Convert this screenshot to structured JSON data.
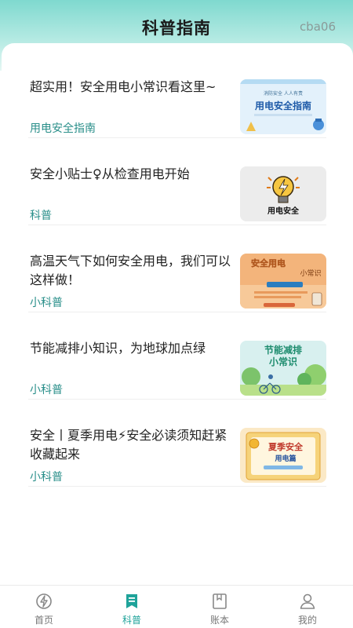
{
  "header": {
    "title": "科普指南",
    "tag": "cba06"
  },
  "articles": [
    {
      "title": "超实用！安全用电小常识看这里~",
      "source": "用电安全指南",
      "thumb": {
        "line1": "消防安全 人人有责",
        "line2": "用电安全指南"
      }
    },
    {
      "title": "安全小贴士♀从检查用电开始",
      "source": "科普",
      "thumb": {
        "line1": "用电安全"
      }
    },
    {
      "title": "高温天气下如何安全用电，我们可以这样做！",
      "source": "小科普",
      "thumb": {
        "line1": "安全用电",
        "line2": "小常识"
      }
    },
    {
      "title": "节能减排小知识，为地球加点绿",
      "source": "小科普",
      "thumb": {
        "line1": "节能减排",
        "line2": "小常识"
      }
    },
    {
      "title": "安全丨夏季用电⚡安全必读须知赶紧收藏起来",
      "source": "小科普",
      "thumb": {
        "line1": "夏季安全",
        "line2": "用电篇"
      }
    }
  ],
  "tabbar": {
    "active_color": "#1fa39a",
    "tabs": [
      {
        "label": "首页",
        "icon": "home-icon"
      },
      {
        "label": "科普",
        "icon": "bookmark-icon"
      },
      {
        "label": "账本",
        "icon": "ledger-icon"
      },
      {
        "label": "我的",
        "icon": "user-icon"
      }
    ]
  }
}
